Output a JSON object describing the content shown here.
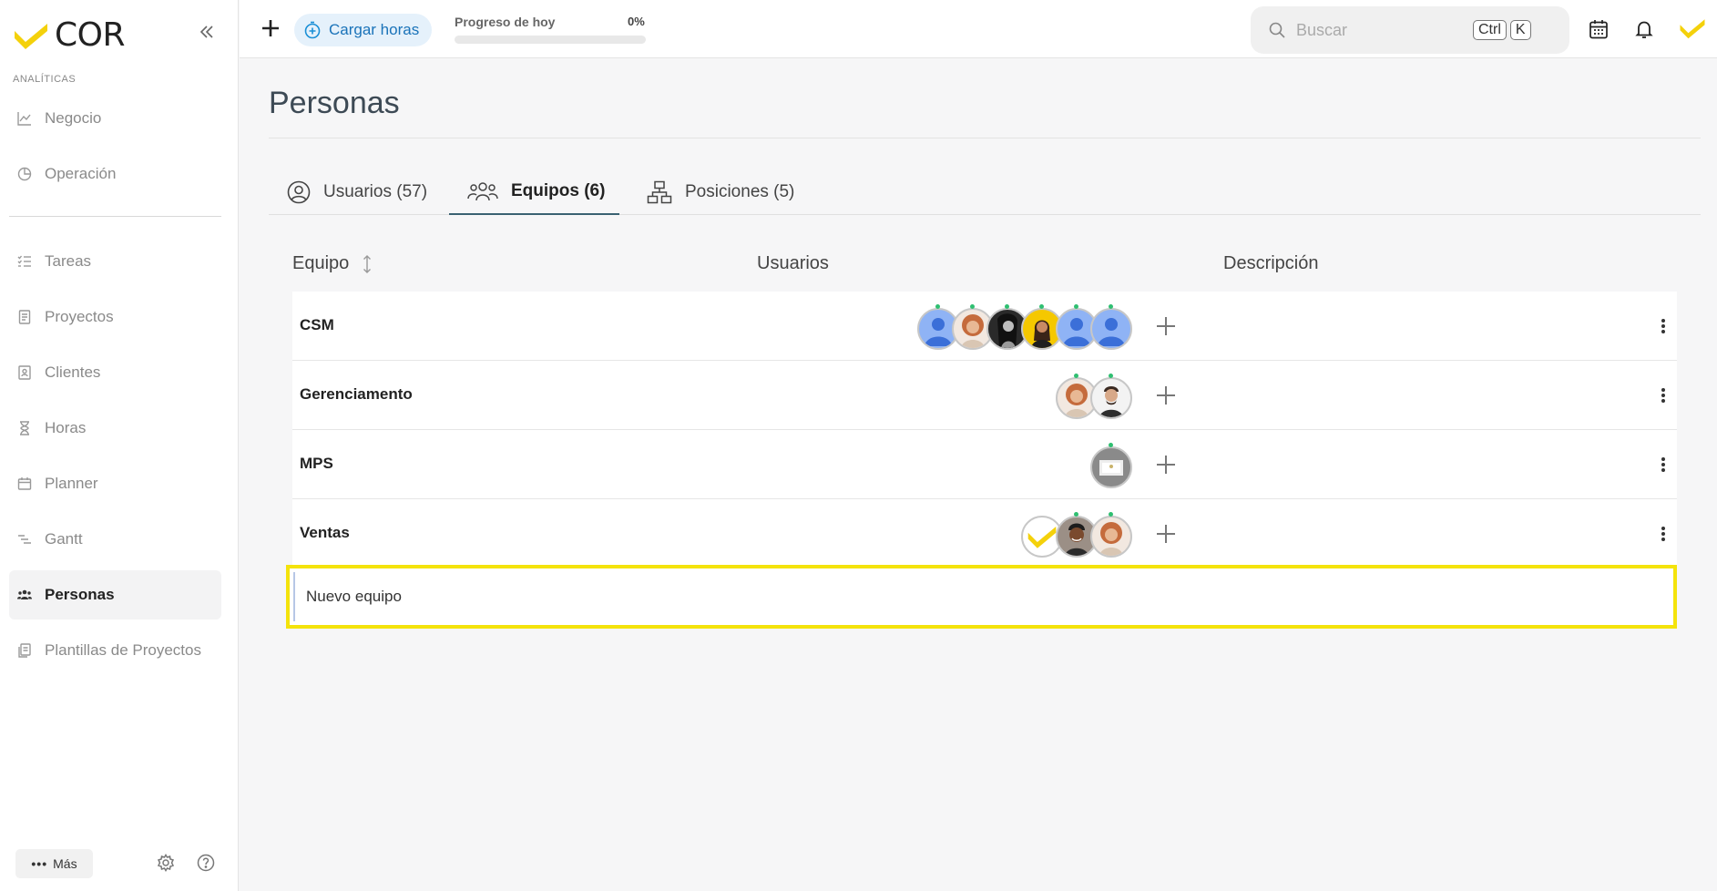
{
  "app": {
    "brand": "COR",
    "accent_color": "#f4d10b"
  },
  "sidebar": {
    "section_label": "ANALÍTICAS",
    "items": [
      {
        "label": "Negocio",
        "icon": "line-chart-icon"
      },
      {
        "label": "Operación",
        "icon": "pie-chart-icon"
      },
      {
        "label": "Tareas",
        "icon": "task-list-icon"
      },
      {
        "label": "Proyectos",
        "icon": "document-icon"
      },
      {
        "label": "Clientes",
        "icon": "contact-card-icon"
      },
      {
        "label": "Horas",
        "icon": "hourglass-icon"
      },
      {
        "label": "Planner",
        "icon": "calendar-plan-icon"
      },
      {
        "label": "Gantt",
        "icon": "gantt-icon"
      },
      {
        "label": "Personas",
        "icon": "people-icon",
        "active": true
      },
      {
        "label": "Plantillas de Proyectos",
        "icon": "templates-icon"
      }
    ],
    "more_label": "Más"
  },
  "topbar": {
    "load_hours_label": "Cargar horas",
    "progress_label": "Progreso de hoy",
    "progress_value": "0%",
    "progress_fraction": 0,
    "search_placeholder": "Buscar",
    "shortcut_ctrl": "Ctrl",
    "shortcut_key": "K"
  },
  "page": {
    "title": "Personas",
    "tabs": [
      {
        "label": "Usuarios (57)",
        "icon": "user-circle-icon"
      },
      {
        "label": "Equipos (6)",
        "icon": "team-icon",
        "active": true
      },
      {
        "label": "Posiciones (5)",
        "icon": "org-chart-icon"
      }
    ]
  },
  "table": {
    "columns": [
      "Equipo",
      "Usuarios",
      "Descripción"
    ],
    "rows": [
      {
        "name": "CSM",
        "avatars": [
          "default",
          "woman-curly",
          "woman-dark",
          "woman-yellow",
          "default",
          "default"
        ]
      },
      {
        "name": "Gerenciamento",
        "avatars": [
          "woman-curly",
          "man-beard"
        ]
      },
      {
        "name": "MPS",
        "avatars": [
          "screen"
        ]
      },
      {
        "name": "Ventas",
        "avatars": [
          "cor-logo",
          "man-smile",
          "woman-curly"
        ]
      }
    ],
    "new_team_value": "Nuevo equipo"
  }
}
